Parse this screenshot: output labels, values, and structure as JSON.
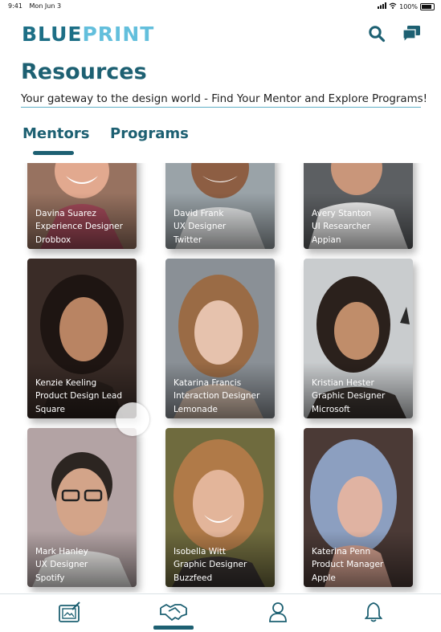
{
  "status_bar": {
    "time": "9:41",
    "date": "Mon Jun 3",
    "battery": "100%"
  },
  "brand": {
    "logo_part1": "BLUE",
    "logo_part2": "PRINT"
  },
  "header": {
    "icons": [
      "search-icon",
      "chat-icon"
    ]
  },
  "page": {
    "title": "Resources",
    "subtitle": "Your gateway to the design world - Find Your Mentor and Explore Programs!"
  },
  "tabs": [
    {
      "label": "Mentors",
      "active": true
    },
    {
      "label": "Programs",
      "active": false
    }
  ],
  "mentors": [
    {
      "name": "Davina Suarez",
      "role": "Experience Designer",
      "company": "Drobbox"
    },
    {
      "name": "David Frank",
      "role": "UX Designer",
      "company": "Twitter"
    },
    {
      "name": "Avery Stanton",
      "role": "UI Researcher",
      "company": "Appian"
    },
    {
      "name": "Kenzie Keeling",
      "role": "Product Design Lead",
      "company": "Square"
    },
    {
      "name": "Katarina Francis",
      "role": "Interaction Designer",
      "company": "Lemonade"
    },
    {
      "name": "Kristian Hester",
      "role": "Graphic Designer",
      "company": "Microsoft"
    },
    {
      "name": "Mark Hanley",
      "role": "UX Designer",
      "company": "Spotify"
    },
    {
      "name": "Isobella Witt",
      "role": "Graphic Designer",
      "company": "Buzzfeed"
    },
    {
      "name": "Katerina Penn",
      "role": "Product Manager",
      "company": "Apple"
    }
  ],
  "bottom_nav": {
    "items": [
      "portfolio-icon",
      "handshake-icon",
      "profile-icon",
      "bell-icon"
    ],
    "active": "handshake-icon"
  },
  "colors": {
    "brand_dark": "#1d6072",
    "brand_light": "#63bfdc",
    "accent_line": "#5eaec6"
  }
}
